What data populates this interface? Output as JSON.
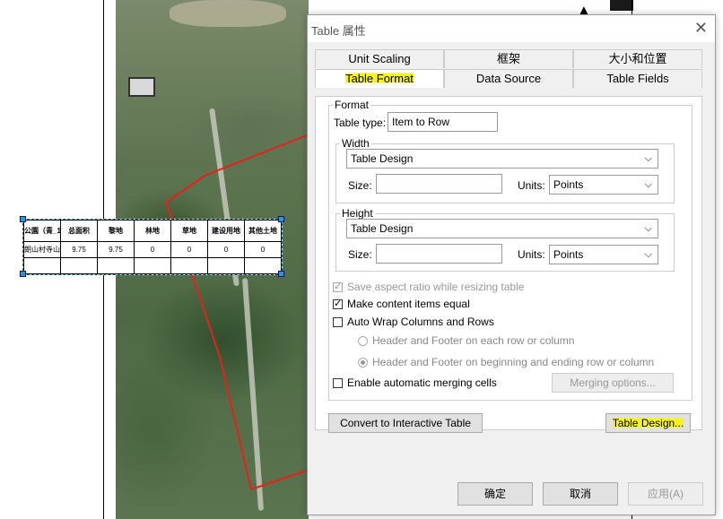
{
  "map": {
    "table_headers": [
      "公園（青_1",
      "总面积",
      "黎地",
      "林地",
      "草地",
      "建设用地",
      "其他土地"
    ],
    "table_row": [
      "朗山村寺山公园",
      "9.75",
      "9.75",
      "0",
      "0",
      "0",
      "0"
    ]
  },
  "dialog": {
    "title": "Table 属性",
    "tabs_top": [
      "Unit Scaling",
      "框架",
      "大小和位置"
    ],
    "tabs_bottom": [
      "Table Format",
      "Data Source",
      "Table Fields"
    ],
    "format_group": "Format",
    "table_type_label": "Table type:",
    "table_type_value": "Item to Row",
    "width": {
      "legend": "Width",
      "mode": "Table Design",
      "size_label": "Size:",
      "size_value": "",
      "units_label": "Units:",
      "units_value": "Points"
    },
    "height": {
      "legend": "Height",
      "mode": "Table Design",
      "size_label": "Size:",
      "size_value": "",
      "units_label": "Units:",
      "units_value": "Points"
    },
    "save_aspect": "Save aspect ratio while resizing table",
    "make_equal": "Make content items equal",
    "auto_wrap": "Auto Wrap Columns and Rows",
    "radio_each": "Header and Footer on each row or column",
    "radio_begin": "Header and Footer on beginning and ending row or column",
    "auto_merge": "Enable automatic merging cells",
    "merging_options": "Merging options...",
    "convert_btn": "Convert to Interactive Table",
    "table_design_btn": "Table Design...",
    "ok_btn": "确定",
    "cancel_btn": "取消",
    "apply_btn": "应用(A)"
  }
}
